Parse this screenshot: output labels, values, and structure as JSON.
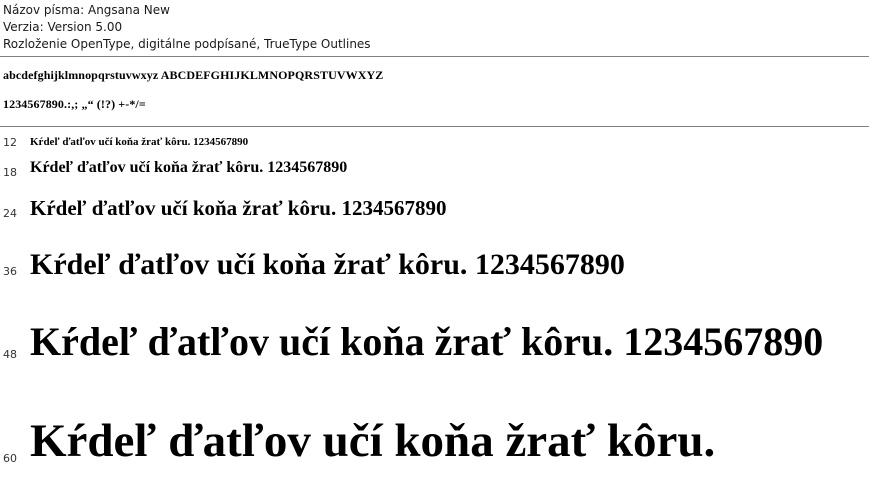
{
  "header": {
    "font_name": "Názov písma: Angsana New",
    "version": "Verzia: Version 5.00",
    "description": "Rozloženie OpenType,  digitálne podpísané, TrueType Outlines"
  },
  "charset": {
    "letters": "abcdefghijklmnopqrstuvwxyz ABCDEFGHIJKLMNOPQRSTUVWXYZ",
    "digits_symbols": "1234567890.:,; „“ (!?) +-*/="
  },
  "samples": [
    {
      "size_label": "12",
      "text": "Kŕdeľ ďatľov učí koňa žrať kôru. 1234567890"
    },
    {
      "size_label": "18",
      "text": "Kŕdeľ ďatľov učí koňa žrať kôru. 1234567890"
    },
    {
      "size_label": "24",
      "text": "Kŕdeľ ďatľov učí koňa žrať kôru. 1234567890"
    },
    {
      "size_label": "36",
      "text": "Kŕdeľ ďatľov učí koňa žrať kôru. 1234567890"
    },
    {
      "size_label": "48",
      "text": "Kŕdeľ ďatľov učí koňa žrať kôru. 1234567890"
    },
    {
      "size_label": "60",
      "text": "Kŕdeľ ďatľov učí koňa žrať kôru."
    }
  ]
}
